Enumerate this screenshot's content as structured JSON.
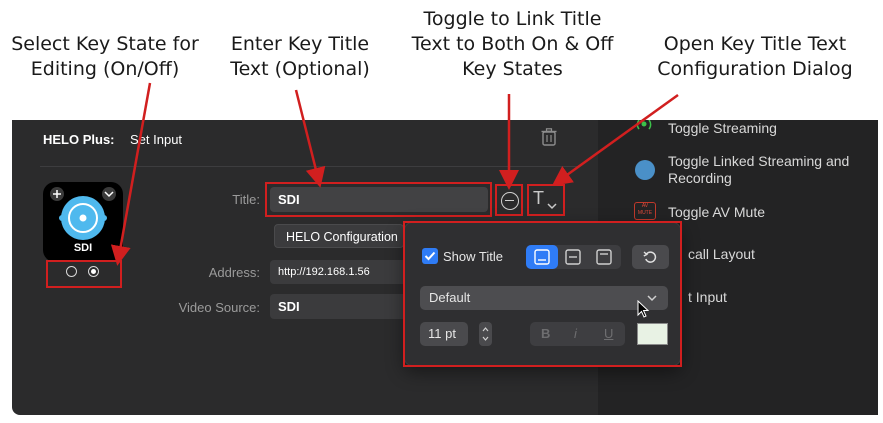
{
  "annotations": {
    "select_state": [
      "Select Key State for",
      "Editing (On/Off)"
    ],
    "enter_title": [
      "Enter Key Title",
      "Text (Optional)"
    ],
    "toggle_link": [
      "Toggle to Link Title",
      "Text to Both On & Off",
      "Key States"
    ],
    "open_config": [
      "Open Key Title Text",
      "Configuration Dialog"
    ]
  },
  "header": {
    "device": "HELO Plus:",
    "action": "Set Input"
  },
  "key": {
    "label": "SDI"
  },
  "form": {
    "title_label": "Title:",
    "title_value": "SDI",
    "helo_config_button": "HELO Configuration",
    "address_label": "Address:",
    "address_value": "http://192.168.1.56",
    "video_source_label": "Video Source:",
    "video_source_value": "SDI",
    "title_format_glyph": "T"
  },
  "right_pane": {
    "items": [
      "Toggle Streaming",
      "Toggle Linked Streaming and",
      "Recording",
      "Toggle AV Mute",
      "call Layout",
      "t Input"
    ],
    "mute_icon_text": [
      "AV",
      "MUTE"
    ]
  },
  "popover": {
    "show_title_label": "Show Title",
    "show_title_checked": true,
    "position_options": [
      "bottom",
      "middle",
      "top"
    ],
    "position_selected": "bottom",
    "font_select": "Default",
    "font_size": "11 pt",
    "style_bold": "B",
    "style_italic": "i",
    "style_underline": "U",
    "color_swatch": "#e8f2e4"
  },
  "colors": {
    "annotation_red": "#d11f1f",
    "accent_blue": "#2f7cf6"
  }
}
